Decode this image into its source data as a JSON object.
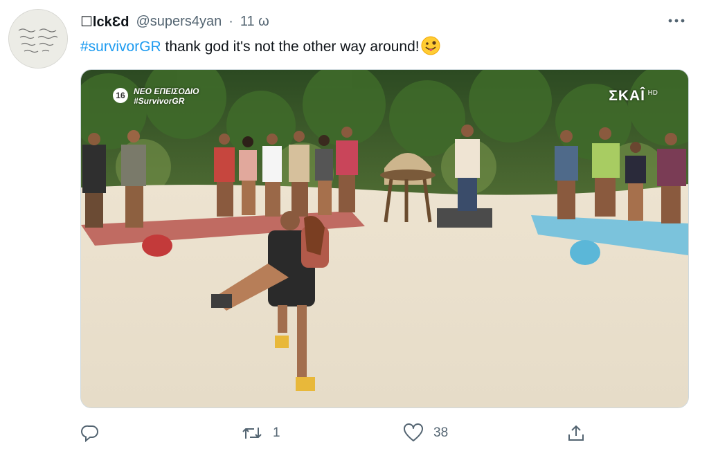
{
  "user": {
    "display_name": "☐lckƐd",
    "handle": "@supers4yan",
    "separator": "·",
    "time": "11 ω"
  },
  "tweet": {
    "hashtag": "#survivorGR",
    "text": " thank god it's not the other way around!",
    "emoji": "zany-face-emoji"
  },
  "media": {
    "episode_number": "16",
    "episode_label": "ΝΕΟ ΕΠΕΙΣΟΔΙΟ",
    "episode_tag": "#SurvivorGR",
    "channel": "ΣΚΑÎ",
    "channel_suffix": "HD"
  },
  "actions": {
    "reply_count": "",
    "retweet_count": "1",
    "like_count": "38",
    "share_count": ""
  },
  "colors": {
    "accent": "#1d9bf0",
    "secondary_text": "#536471",
    "red_team": "#c0463f",
    "blue_team": "#5bb7d8"
  }
}
